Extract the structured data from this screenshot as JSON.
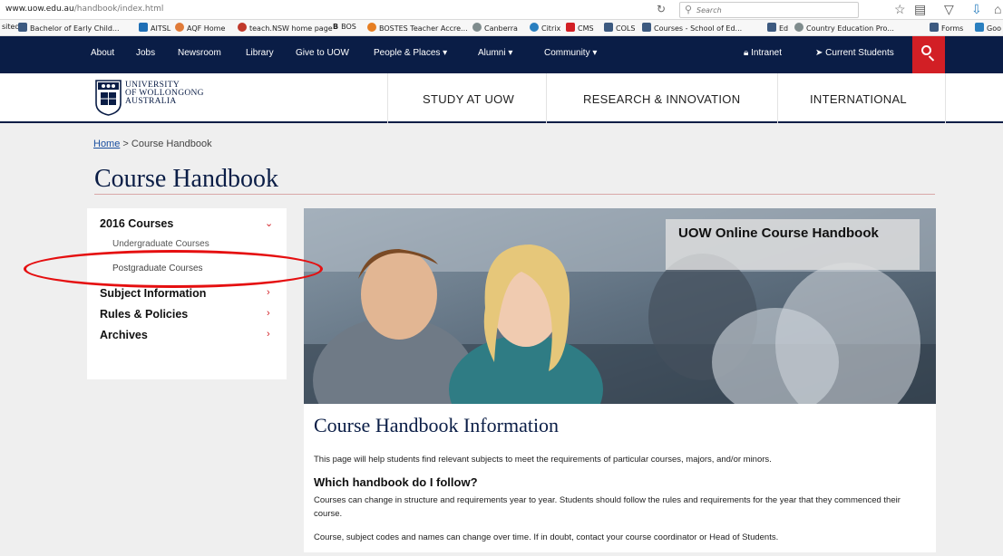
{
  "browser": {
    "url_domain": "www.uow.edu.au",
    "url_path": "/handbook/index.html",
    "search_placeholder": "Search"
  },
  "bookmarks": [
    {
      "label": "sited",
      "icon": "none",
      "color": "#ffffff"
    },
    {
      "label": "Bachelor of Early Child...",
      "icon": "page-icon",
      "color": "#3d5a80"
    },
    {
      "label": "AITSL",
      "icon": "page-icon",
      "color": "#1f6fb5"
    },
    {
      "label": "AQF Home",
      "icon": "page-icon",
      "color": "#e07b39"
    },
    {
      "label": "teach.NSW home page",
      "icon": "page-icon",
      "color": "#c0392b"
    },
    {
      "label": "BOS",
      "icon": "page-icon",
      "color": "#ffffff"
    },
    {
      "label": "BOSTES Teacher Accre...",
      "icon": "page-icon",
      "color": "#e67e22"
    },
    {
      "label": "Canberra",
      "icon": "page-icon",
      "color": "#7f8c8d"
    },
    {
      "label": "Citrix",
      "icon": "page-icon",
      "color": "#2a7fbf"
    },
    {
      "label": "CMS",
      "icon": "page-icon",
      "color": "#d21f25"
    },
    {
      "label": "COLS",
      "icon": "page-icon",
      "color": "#3d5a80"
    },
    {
      "label": "Courses - School of Ed...",
      "icon": "page-icon",
      "color": "#3d5a80"
    },
    {
      "label": "Ed",
      "icon": "page-icon",
      "color": "#3d5a80"
    },
    {
      "label": "Country Education Pro...",
      "icon": "page-icon",
      "color": "#7f8c8d"
    },
    {
      "label": "Forms",
      "icon": "page-icon",
      "color": "#3d5a80"
    },
    {
      "label": "Goo",
      "icon": "page-icon",
      "color": "#2a7fbf"
    }
  ],
  "topnav": {
    "items": [
      "About",
      "Jobs",
      "Newsroom",
      "Library",
      "Give to UOW",
      "People & Places ▾",
      "Alumni ▾",
      "Community ▾"
    ],
    "intranet": "Intranet",
    "current_students": "Current Students"
  },
  "logo": {
    "line1": "UNIVERSITY",
    "line2": "OF WOLLONGONG",
    "line3": "AUSTRALIA"
  },
  "main_nav": [
    "STUDY AT UOW",
    "RESEARCH & INNOVATION",
    "INTERNATIONAL"
  ],
  "breadcrumb": {
    "home": "Home",
    "separator": ">",
    "current": "Course Handbook"
  },
  "page_title": "Course Handbook",
  "sidebar": {
    "section": "2016 Courses",
    "subitems": [
      "Undergraduate Courses",
      "Postgraduate Courses"
    ],
    "items": [
      "Subject Information",
      "Rules & Policies",
      "Archives"
    ]
  },
  "hero": {
    "caption": "UOW Online Course Handbook"
  },
  "info": {
    "title": "Course Handbook Information",
    "p1": "This page will help students find relevant subjects to meet the requirements of particular courses, majors, and/or minors.",
    "h3": "Which handbook do I follow?",
    "p2": "Courses can change in structure and requirements year to year. Students should follow the rules and requirements for the year that they commenced their course.",
    "p3": "Course, subject codes and names can change over time. If in doubt, contact your course coordinator or Head of Students."
  },
  "colors": {
    "navy": "#0a1d46",
    "red": "#d21f25",
    "link": "#1a4fa0",
    "annotation": "#e50f10"
  }
}
